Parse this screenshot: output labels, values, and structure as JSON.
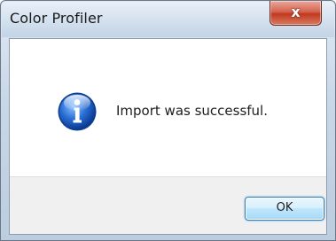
{
  "window": {
    "title": "Color Profiler",
    "close_glyph": "x"
  },
  "dialog": {
    "icon": "info-icon",
    "message": "Import was successful."
  },
  "buttons": {
    "ok_label": "OK"
  },
  "colors": {
    "accent": "#3c7fb1",
    "close_button": "#c0391f",
    "footer": "#f0f0f0"
  }
}
